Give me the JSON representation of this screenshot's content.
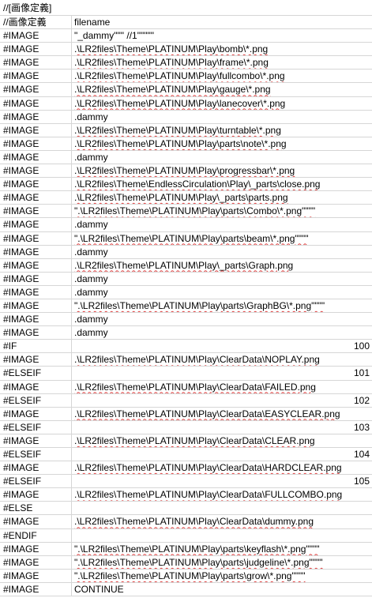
{
  "sheet": {
    "header_cell": "//[画像定義]",
    "rows": [
      {
        "a": "//画像定義",
        "b": "filename",
        "num": false
      },
      {
        "a": "#IMAGE",
        "b": "\"_dammy\"\"\"               //1\"\"\"\"\"",
        "num": false
      },
      {
        "a": "#IMAGE",
        "b": ".\\LR2files\\Theme\\PLATINUM\\Play\\bomb\\*.png",
        "num": false
      },
      {
        "a": "#IMAGE",
        "b": ".\\LR2files\\Theme\\PLATINUM\\Play\\frame\\*.png",
        "num": false
      },
      {
        "a": "#IMAGE",
        "b": ".\\LR2files\\Theme\\PLATINUM\\Play\\fullcombo\\*.png",
        "num": false
      },
      {
        "a": "#IMAGE",
        "b": ".\\LR2files\\Theme\\PLATINUM\\Play\\gauge\\*.png",
        "num": false
      },
      {
        "a": "#IMAGE",
        "b": ".\\LR2files\\Theme\\PLATINUM\\Play\\lanecover\\*.png",
        "num": false
      },
      {
        "a": "#IMAGE",
        "b": ".dammy",
        "num": false
      },
      {
        "a": "#IMAGE",
        "b": ".\\LR2files\\Theme\\PLATINUM\\Play\\turntable\\*.png",
        "num": false
      },
      {
        "a": "#IMAGE",
        "b": ".\\LR2files\\Theme\\PLATINUM\\Play\\parts\\note\\*.png",
        "num": false
      },
      {
        "a": "#IMAGE",
        "b": ".dammy",
        "num": false
      },
      {
        "a": "#IMAGE",
        "b": ".\\LR2files\\Theme\\PLATINUM\\Play\\progressbar\\*.png",
        "num": false
      },
      {
        "a": "#IMAGE",
        "b": ".\\LR2files\\Theme\\EndlessCirculation\\Play\\_parts\\close.png",
        "num": false
      },
      {
        "a": "#IMAGE",
        "b": ".\\LR2files\\Theme\\PLATINUM\\Play\\_parts\\parts.png",
        "num": false
      },
      {
        "a": "#IMAGE",
        "b": "\".\\LR2files\\Theme\\PLATINUM\\Play\\parts\\Combo\\*.png\"\"\"\"",
        "num": false
      },
      {
        "a": "#IMAGE",
        "b": ".dammy",
        "num": false
      },
      {
        "a": "#IMAGE",
        "b": "\".\\LR2files\\Theme\\PLATINUM\\Play\\parts\\beam\\*.png\"\"\"\"",
        "num": false
      },
      {
        "a": "#IMAGE",
        "b": ".dammy",
        "num": false
      },
      {
        "a": "#IMAGE",
        "b": ".\\LR2files\\Theme\\PLATINUM\\Play\\_parts\\Graph.png",
        "num": false
      },
      {
        "a": "#IMAGE",
        "b": ".dammy",
        "num": false
      },
      {
        "a": "#IMAGE",
        "b": ".dammy",
        "num": false
      },
      {
        "a": "#IMAGE",
        "b": "\".\\LR2files\\Theme\\PLATINUM\\Play\\parts\\GraphBG\\*.png\"\"\"\"",
        "num": false
      },
      {
        "a": "#IMAGE",
        "b": ".dammy",
        "num": false
      },
      {
        "a": "#IMAGE",
        "b": ".dammy",
        "num": false
      },
      {
        "a": "#IF",
        "b": "100",
        "num": true
      },
      {
        "a": "#IMAGE",
        "b": ".\\LR2files\\Theme\\PLATINUM\\Play\\ClearData\\NOPLAY.png",
        "num": false
      },
      {
        "a": "#ELSEIF",
        "b": "101",
        "num": true
      },
      {
        "a": "#IMAGE",
        "b": ".\\LR2files\\Theme\\PLATINUM\\Play\\ClearData\\FAILED.png",
        "num": false
      },
      {
        "a": "#ELSEIF",
        "b": "102",
        "num": true
      },
      {
        "a": "#IMAGE",
        "b": ".\\LR2files\\Theme\\PLATINUM\\Play\\ClearData\\EASYCLEAR.png",
        "num": false
      },
      {
        "a": "#ELSEIF",
        "b": "103",
        "num": true
      },
      {
        "a": "#IMAGE",
        "b": ".\\LR2files\\Theme\\PLATINUM\\Play\\ClearData\\CLEAR.png",
        "num": false
      },
      {
        "a": "#ELSEIF",
        "b": "104",
        "num": true
      },
      {
        "a": "#IMAGE",
        "b": ".\\LR2files\\Theme\\PLATINUM\\Play\\ClearData\\HARDCLEAR.png",
        "num": false
      },
      {
        "a": "#ELSEIF",
        "b": "105",
        "num": true
      },
      {
        "a": "#IMAGE",
        "b": ".\\LR2files\\Theme\\PLATINUM\\Play\\ClearData\\FULLCOMBO.png",
        "num": false
      },
      {
        "a": "#ELSE",
        "b": "",
        "num": false
      },
      {
        "a": "#IMAGE",
        "b": ".\\LR2files\\Theme\\PLATINUM\\Play\\ClearData\\dummy.png",
        "num": false
      },
      {
        "a": "#ENDIF",
        "b": "",
        "num": false
      },
      {
        "a": "#IMAGE",
        "b": "\".\\LR2files\\Theme\\PLATINUM\\Play\\parts\\keyflash\\*.png\"\"\"\"",
        "num": false
      },
      {
        "a": "#IMAGE",
        "b": "\".\\LR2files\\Theme\\PLATINUM\\Play\\parts\\judgeline\\*.png\"\"\"\"",
        "num": false
      },
      {
        "a": "#IMAGE",
        "b": "\".\\LR2files\\Theme\\PLATINUM\\Play\\parts\\grow\\*.png\"\"\"\"",
        "num": false
      },
      {
        "a": "#IMAGE",
        "b": "CONTINUE",
        "num": false
      }
    ]
  },
  "colors": {
    "gridline": "#d6d6d6",
    "spellcheck": "#e04040"
  }
}
